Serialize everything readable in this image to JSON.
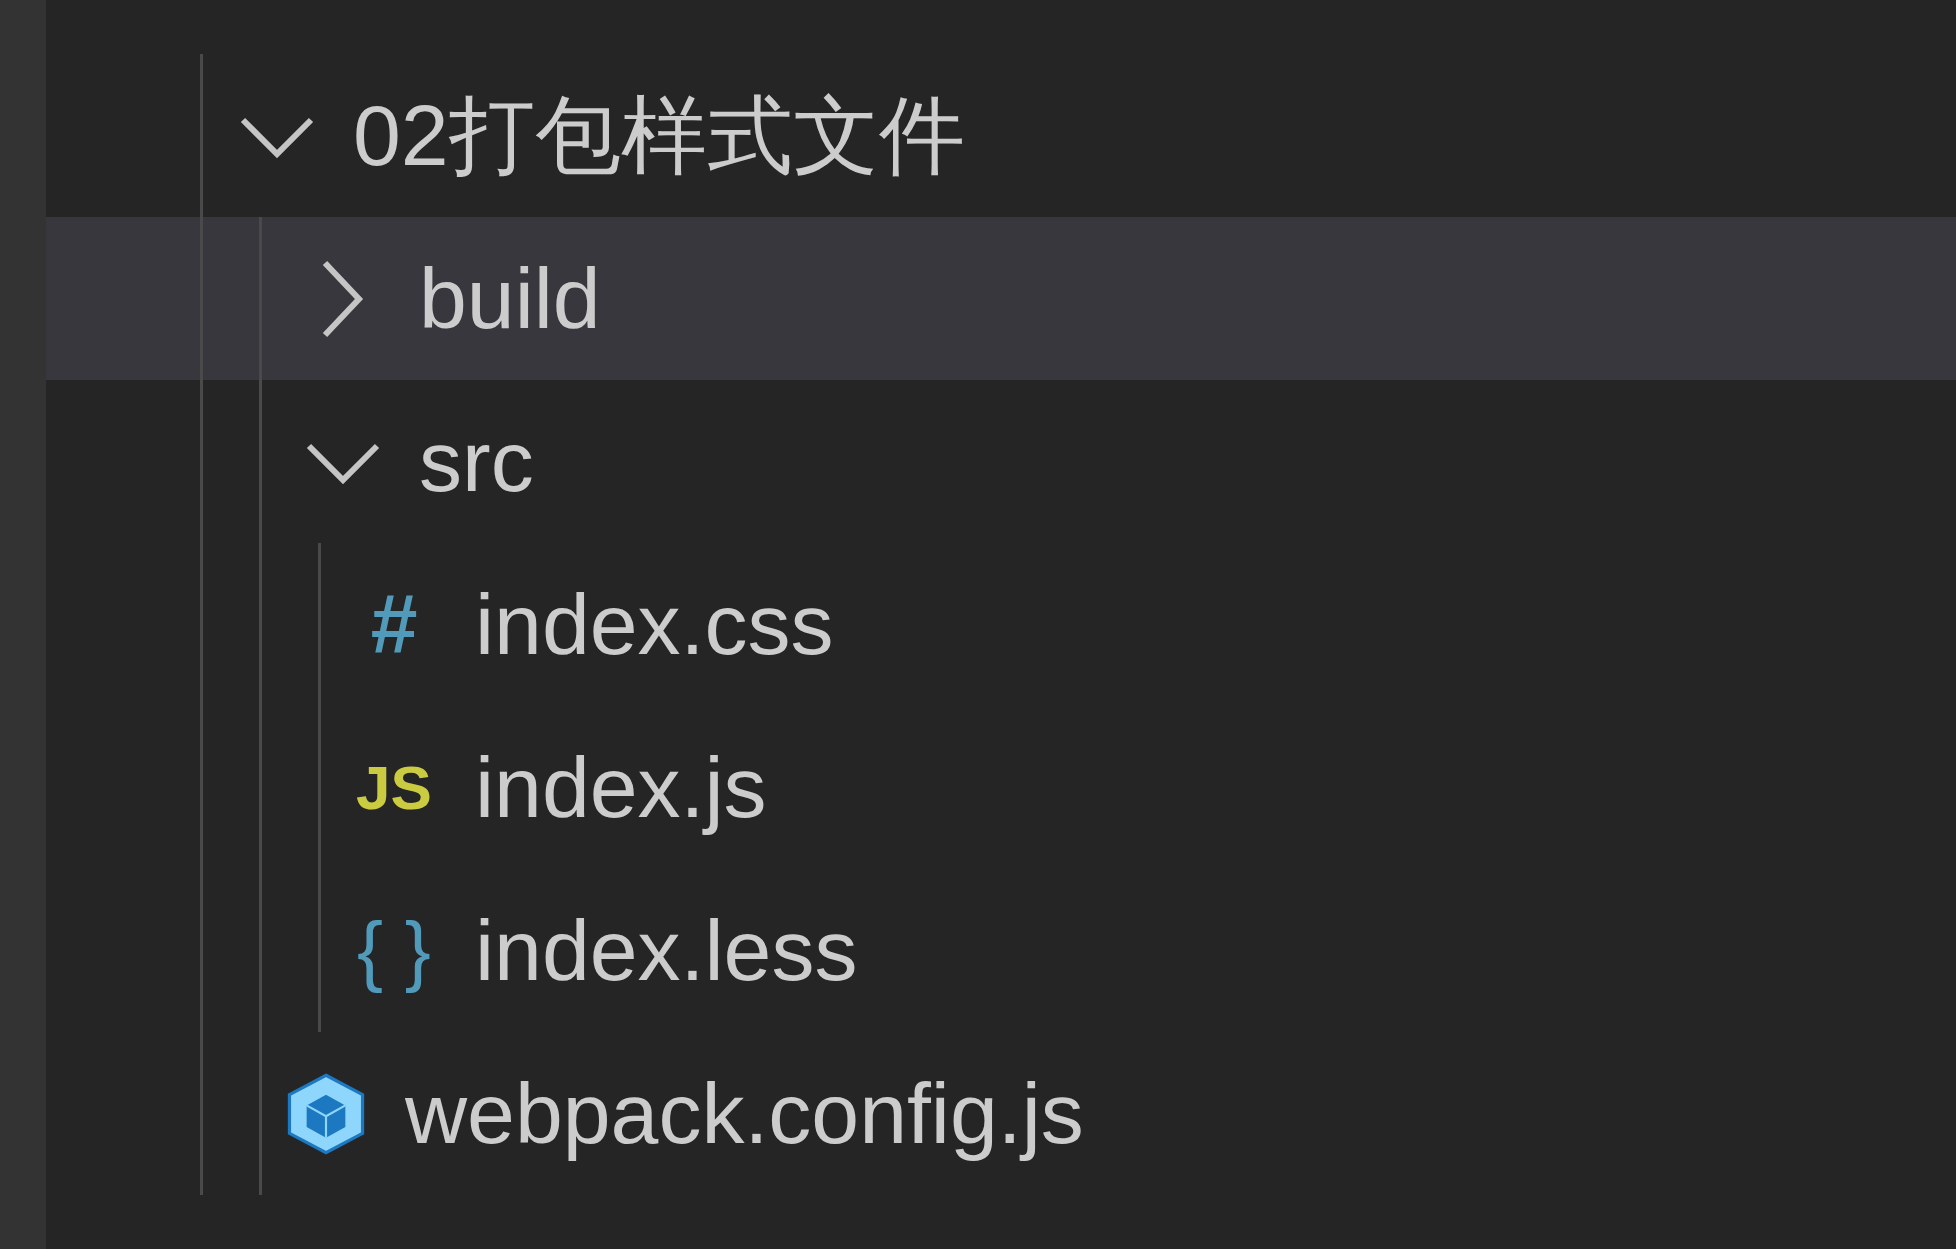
{
  "tree": [
    {
      "kind": "folder",
      "label": "02打包样式文件",
      "expanded": true,
      "selected": false,
      "children": [
        {
          "kind": "folder",
          "label": "build",
          "expanded": false,
          "selected": true
        },
        {
          "kind": "folder",
          "label": "src",
          "expanded": true,
          "selected": false,
          "children": [
            {
              "kind": "css",
              "icon": "#",
              "label": "index.css",
              "selected": false
            },
            {
              "kind": "js",
              "icon": "JS",
              "label": "index.js",
              "selected": false
            },
            {
              "kind": "less",
              "icon": "{ }",
              "label": "index.less",
              "selected": false
            }
          ]
        },
        {
          "kind": "webpack",
          "label": "webpack.config.js",
          "selected": false
        }
      ]
    }
  ]
}
